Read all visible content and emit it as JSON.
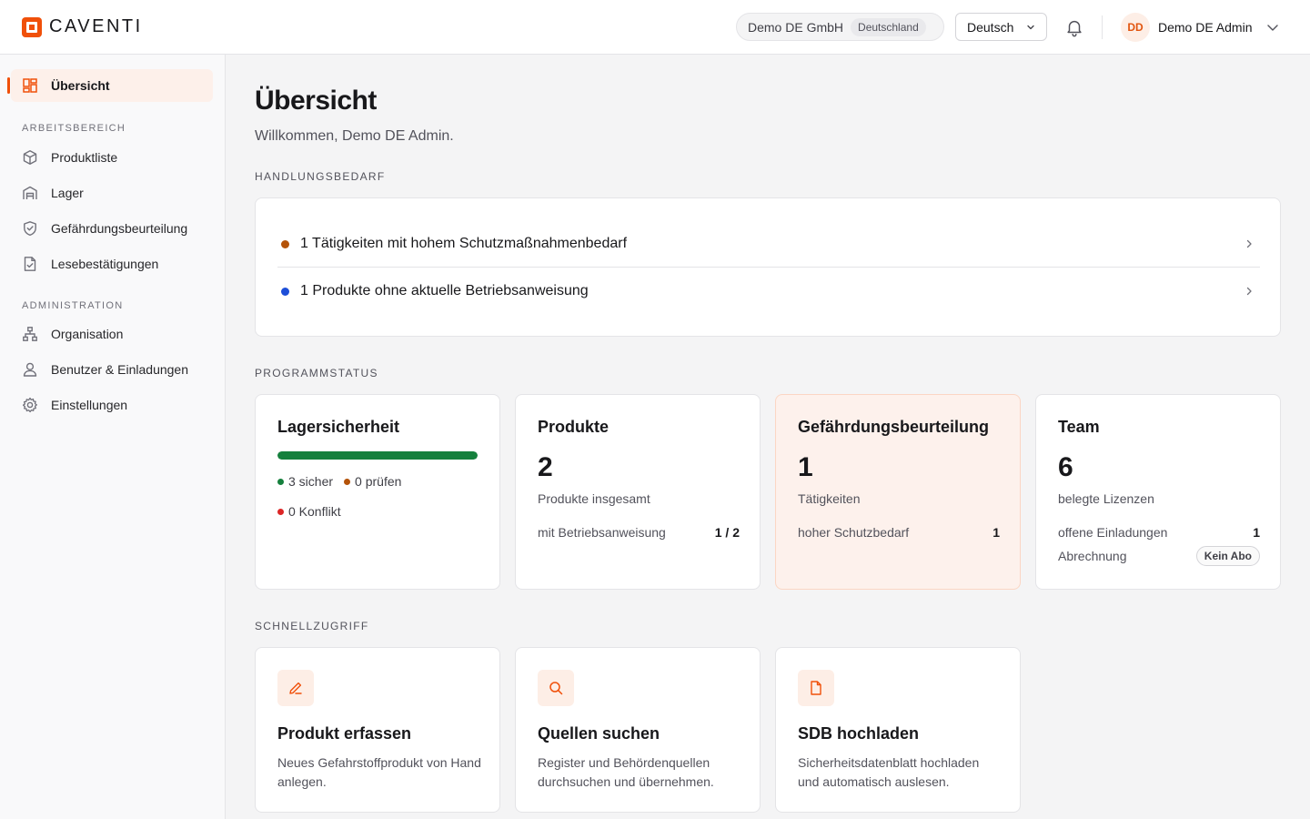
{
  "brand": {
    "name": "CAVENTI",
    "accent": "#f0500a"
  },
  "header": {
    "org_name": "Demo DE GmbH",
    "org_country": "Deutschland",
    "language": "Deutsch",
    "user_initials": "DD",
    "user_name": "Demo DE Admin"
  },
  "sidebar": {
    "active": {
      "label": "Übersicht",
      "icon": "dashboard-icon"
    },
    "sections": [
      {
        "title": "ARBEITSBEREICH",
        "items": [
          {
            "label": "Produktliste",
            "icon": "box-icon"
          },
          {
            "label": "Lager",
            "icon": "warehouse-icon"
          },
          {
            "label": "Gefährdungsbeurteilung",
            "icon": "shield-icon"
          },
          {
            "label": "Lesebestätigungen",
            "icon": "document-check-icon"
          }
        ]
      },
      {
        "title": "ADMINISTRATION",
        "items": [
          {
            "label": "Organisation",
            "icon": "org-chart-icon"
          },
          {
            "label": "Benutzer & Einladungen",
            "icon": "user-icon"
          },
          {
            "label": "Einstellungen",
            "icon": "gear-icon"
          }
        ]
      }
    ]
  },
  "main": {
    "title": "Übersicht",
    "welcome": "Willkommen, Demo DE Admin.",
    "action_section": "HANDLUNGSBEDARF",
    "actions": [
      {
        "text": "1 Tätigkeiten mit hohem Schutzmaßnahmenbedarf",
        "color": "#b45309"
      },
      {
        "text": "1 Produkte ohne aktuelle Betriebsanweisung",
        "color": "#1d4ed8"
      }
    ],
    "status_section": "PROGRAMMSTATUS",
    "storage": {
      "title": "Lagersicherheit",
      "progress": 1.0,
      "safe": "3 sicher",
      "check": "0 prüfen",
      "conflict": "0 Konflikt",
      "colors": {
        "safe": "#15803d",
        "check": "#b45309",
        "conflict": "#dc2626"
      }
    },
    "products": {
      "title": "Produkte",
      "count": "2",
      "sub": "Produkte insgesamt",
      "line_label": "mit Betriebsanweisung",
      "line_value": "1 / 2"
    },
    "risk": {
      "title": "Gefährdungsbeurteilung",
      "count": "1",
      "sub": "Tätigkeiten",
      "line_label": "hoher Schutzbedarf",
      "line_value": "1"
    },
    "team": {
      "title": "Team",
      "count": "6",
      "sub": "belegte Lizenzen",
      "invites_label": "offene Einladungen",
      "invites_value": "1",
      "billing_label": "Abrechnung",
      "billing_value": "Kein Abo"
    },
    "quick_section": "SCHNELLZUGRIFF",
    "quick": [
      {
        "title": "Produkt erfassen",
        "desc": "Neues Gefahrstoffprodukt von Hand anlegen.",
        "icon": "pencil-icon"
      },
      {
        "title": "Quellen suchen",
        "desc": "Register und Behördenquellen durchsuchen und übernehmen.",
        "icon": "search-icon"
      },
      {
        "title": "SDB hochladen",
        "desc": "Sicherheitsdatenblatt hochladen und automatisch auslesen.",
        "icon": "file-icon"
      }
    ]
  }
}
